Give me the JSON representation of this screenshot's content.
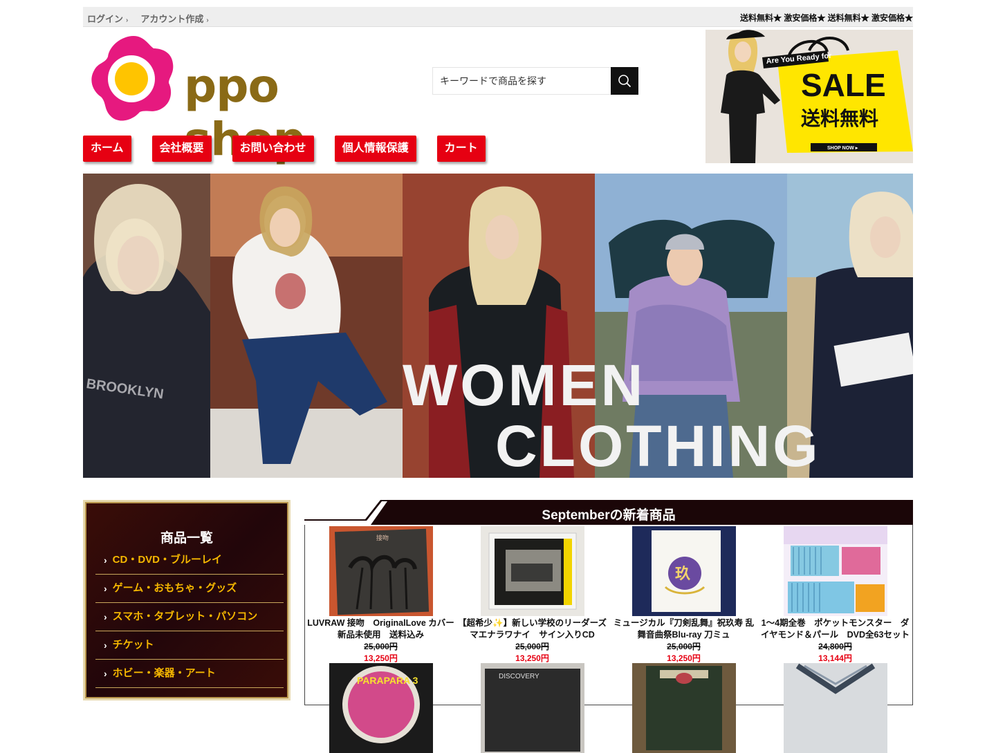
{
  "topbar": {
    "login": "ログイン",
    "register": "アカウント作成",
    "marquee": "送料無料★ 激安価格★ 送料無料★ 激安価格★"
  },
  "logo": {
    "text": "ppo shop"
  },
  "search": {
    "placeholder": "キーワードで商品を探す"
  },
  "ad": {
    "line1": "Are You Ready for",
    "line2": "SALE",
    "line3": "送料無料",
    "cta": "SHOP NOW ▸"
  },
  "nav": [
    "ホーム",
    "会社概要",
    "お問い合わせ",
    "個人情報保護",
    "カート"
  ],
  "hero": {
    "line1": "WOMEN",
    "line2": "CLOTHING"
  },
  "sidebar": {
    "title": "商品一覧",
    "items": [
      "CD・DVD・ブルーレイ",
      "ゲーム・おもちゃ・グッズ",
      "スマホ・タブレット・パソコン",
      "チケット",
      "ホビー・楽器・アート"
    ]
  },
  "products": {
    "title": "Septemberの新着商品",
    "items": [
      {
        "name": "LUVRAW 接吻　OriginalLove カバー新品未使用　送料込み",
        "old": "25,000円",
        "price": "13,250円"
      },
      {
        "name": "【超希少✨】新しい学校のリーダーズ マエナラワナイ　サイン入りCD",
        "old": "25,000円",
        "price": "13,250円"
      },
      {
        "name": "ミュージカル『刀剣乱舞』祝玖寿 乱舞音曲祭Blu-ray 刀ミュ",
        "old": "25,000円",
        "price": "13,250円"
      },
      {
        "name": "1〜4期全巻　ポケットモンスター　ダイヤモンド＆パール　DVD全63セット",
        "old": "24,800円",
        "price": "13,144円"
      }
    ]
  },
  "colors": {
    "accent": "#e60012",
    "sidebar_text": "#f5b700",
    "logo_pink": "#e6197f",
    "logo_yellow": "#ffc400"
  },
  "icons": {
    "search": "search-icon",
    "chevron": "chevron-right-icon"
  }
}
